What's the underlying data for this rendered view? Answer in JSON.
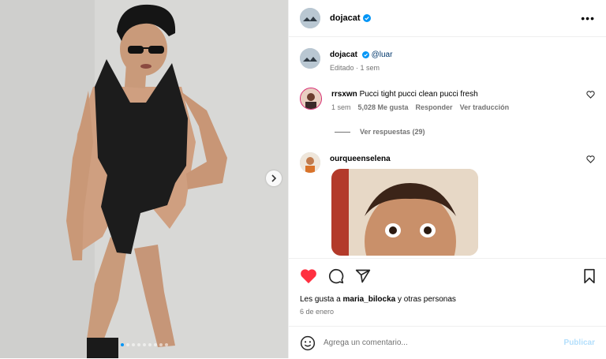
{
  "post": {
    "author": "dojacat",
    "more_label": "•••",
    "caption_mention": "@luar",
    "edited_meta": "Editado · 1 sem",
    "carousel": {
      "total": 9,
      "active_index": 0
    }
  },
  "comments": [
    {
      "user": "rrsxwn",
      "text": "Pucci tight pucci clean pucci fresh",
      "time": "1 sem",
      "likes": "5,028 Me gusta",
      "reply_label": "Responder",
      "translate_label": "Ver traducción",
      "view_replies": "Ver respuestas (29)"
    },
    {
      "user": "ourqueenselena"
    }
  ],
  "actions": {
    "liked": true,
    "likes_prefix": "Les gusta a",
    "likes_user": "maria_bilocka",
    "likes_suffix": "y otras personas",
    "date": "6 de enero"
  },
  "composer": {
    "placeholder": "Agrega un comentario...",
    "post_label": "Publicar"
  },
  "colors": {
    "like_red": "#ff3040",
    "verified_blue": "#0095f6",
    "link_blue": "#00376b",
    "post_disabled": "#b3dffc"
  }
}
